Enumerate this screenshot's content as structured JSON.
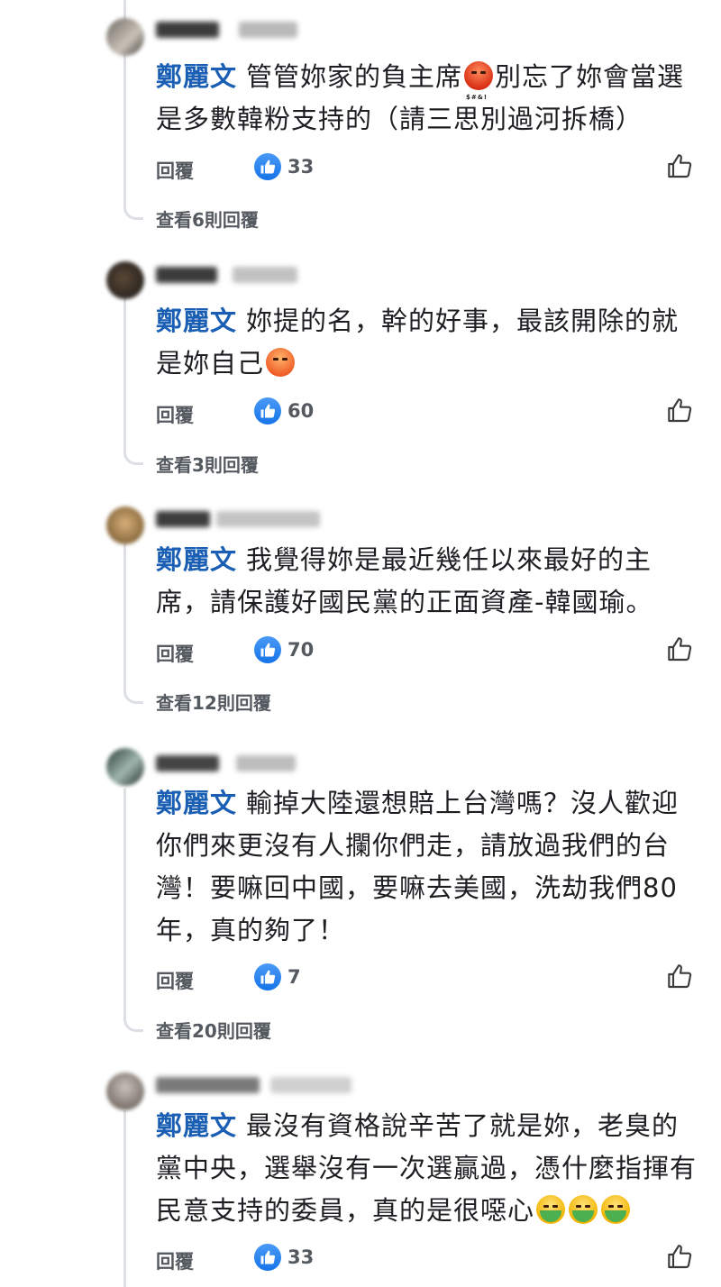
{
  "comments": [
    {
      "author": "鄭麗文",
      "lines": [
        "管管妳家的負主席",
        "別忘了妳會當選",
        "是多數韓粉支持的（請三思別過河拆橋）"
      ],
      "emoji": "face-with-symbols-on-mouth",
      "reply_label": "回覆",
      "like_count": "33",
      "view_replies": "查看6則回覆"
    },
    {
      "author": "鄭麗文",
      "lines": [
        "妳提的名，幹的好事，最該開除的就",
        "是妳自己"
      ],
      "emoji": "angry-face",
      "reply_label": "回覆",
      "like_count": "60",
      "view_replies": "查看3則回覆"
    },
    {
      "author": "鄭麗文",
      "lines": [
        "我覺得妳是最近幾任以來最好的主",
        "席，請保護好國民黨的正面資產-韓國瑜。"
      ],
      "reply_label": "回覆",
      "like_count": "70",
      "view_replies": "查看12則回覆"
    },
    {
      "author": "鄭麗文",
      "lines": [
        "輸掉大陸還想賠上台灣嗎？沒人歡迎",
        "你們來更沒有人攔你們走，請放過我們的台",
        "灣！要嘛回中國，要嘛去美國，洗劫我們80",
        "年，真的夠了！"
      ],
      "reply_label": "回覆",
      "like_count": "7",
      "view_replies": "查看20則回覆"
    },
    {
      "author": "鄭麗文",
      "lines": [
        "最沒有資格說辛苦了就是妳，老臭的",
        "黨中央，選舉沒有一次選贏過，憑什麼指揮有",
        "民意支持的委員，真的是很噁心"
      ],
      "emoji": "nauseated-face",
      "reply_label": "回覆",
      "like_count": "33"
    }
  ],
  "colors": {
    "mention": "#1a5fb4",
    "like_badge": "#1674e8",
    "thread_line": "#dcdfe3",
    "meta_text": "#555a61"
  }
}
